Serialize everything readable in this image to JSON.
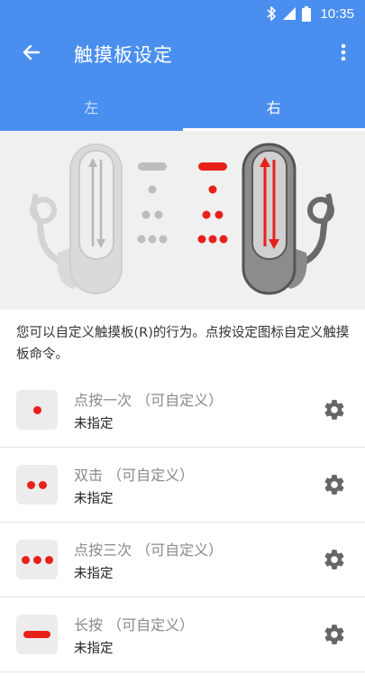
{
  "status_bar": {
    "time": "10:35",
    "icons": [
      "bluetooth-icon",
      "signal-icon",
      "battery-icon"
    ]
  },
  "app_bar": {
    "title": "触摸板设定",
    "back_icon": "arrow-back-icon",
    "more_icon": "more-vert-icon"
  },
  "tabs": [
    {
      "label": "左",
      "selected": false
    },
    {
      "label": "右",
      "selected": true
    }
  ],
  "description": "您可以自定义触摸板(R)的行为。点按设定图标自定义触摸板命令。",
  "commands": [
    {
      "title": "点按一次 （可自定义）",
      "subtitle": "未指定",
      "gesture_icon": "single-dot-icon"
    },
    {
      "title": "双击 （可自定义）",
      "subtitle": "未指定",
      "gesture_icon": "double-dot-icon"
    },
    {
      "title": "点按三次 （可自定义）",
      "subtitle": "未指定",
      "gesture_icon": "triple-dot-icon"
    },
    {
      "title": "长按 （可自定义）",
      "subtitle": "未指定",
      "gesture_icon": "long-press-bar-icon"
    }
  ],
  "colors": {
    "primary": "#4a8ff0",
    "accent_red": "#e8201a",
    "inactive_gray": "#bdbdbd",
    "active_device": "#7a7a7a"
  }
}
